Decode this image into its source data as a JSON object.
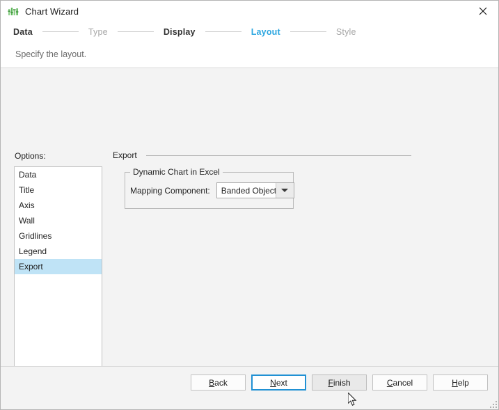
{
  "window": {
    "title": "Chart Wizard",
    "icon": "chart-bars-icon",
    "close_label": "close-icon",
    "accent_blue": "#2ba6e0",
    "focus_blue": "#2191d4",
    "selection_blue": "#bfe3f6",
    "body_bg": "#f3f3f3"
  },
  "stepper": {
    "steps": [
      {
        "label": "Data",
        "state": "done"
      },
      {
        "label": "Type",
        "state": "todo"
      },
      {
        "label": "Display",
        "state": "done"
      },
      {
        "label": "Layout",
        "state": "active"
      },
      {
        "label": "Style",
        "state": "todo"
      }
    ]
  },
  "subtitle": {
    "text": "Specify the layout."
  },
  "options": {
    "label": "Options:",
    "items": [
      {
        "label": "Data",
        "selected": false
      },
      {
        "label": "Title",
        "selected": false
      },
      {
        "label": "Axis",
        "selected": false
      },
      {
        "label": "Wall",
        "selected": false
      },
      {
        "label": "Gridlines",
        "selected": false
      },
      {
        "label": "Legend",
        "selected": false
      },
      {
        "label": "Export",
        "selected": true
      }
    ]
  },
  "pane": {
    "header": "Export",
    "group": {
      "title": "Dynamic Chart in Excel",
      "mapping": {
        "label": "Mapping Component:",
        "value": "Banded Object",
        "options": [
          "Banded Object"
        ]
      }
    }
  },
  "footer": {
    "buttons": [
      {
        "label": "Back",
        "mnemonic": "B",
        "state": "normal"
      },
      {
        "label": "Next",
        "mnemonic": "N",
        "state": "default"
      },
      {
        "label": "Finish",
        "mnemonic": "F",
        "state": "hovered"
      },
      {
        "label": "Cancel",
        "mnemonic": "C",
        "state": "normal"
      },
      {
        "label": "Help",
        "mnemonic": "H",
        "state": "normal"
      }
    ]
  }
}
